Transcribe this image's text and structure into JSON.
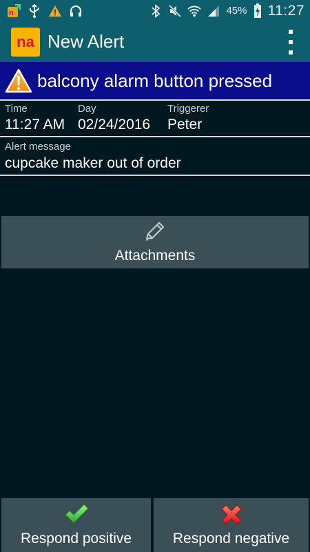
{
  "status_bar": {
    "left_icons": [
      "notification-app-icon",
      "usb-icon",
      "warning-icon",
      "headset-icon"
    ],
    "right_icons": [
      "bluetooth-icon",
      "mute-icon",
      "wifi-icon",
      "signal-icon",
      "battery-charging-icon"
    ],
    "battery_percent": "45%",
    "time": "11:27"
  },
  "action_bar": {
    "logo_text": "na",
    "title": "New Alert",
    "overflow_icon": "overflow-menu-icon"
  },
  "alert": {
    "icon": "warning-triangle-icon",
    "title": "balcony alarm button pressed",
    "time_label": "Time",
    "time_value": "11:27 AM",
    "day_label": "Day",
    "day_value": "02/24/2016",
    "triggerer_label": "Triggerer",
    "triggerer_value": "Peter",
    "message_label": "Alert message",
    "message_value": "cupcake maker out of order"
  },
  "attachments": {
    "icon": "pencil-icon",
    "label": "Attachments"
  },
  "respond": {
    "positive_icon": "checkmark-icon",
    "positive_label": "Respond positive",
    "negative_icon": "cross-icon",
    "negative_label": "Respond negative"
  },
  "colors": {
    "status_bar": "#0e5f6e",
    "alert_header": "#0a0d8c",
    "background": "#021820",
    "button": "#3b4f57"
  }
}
